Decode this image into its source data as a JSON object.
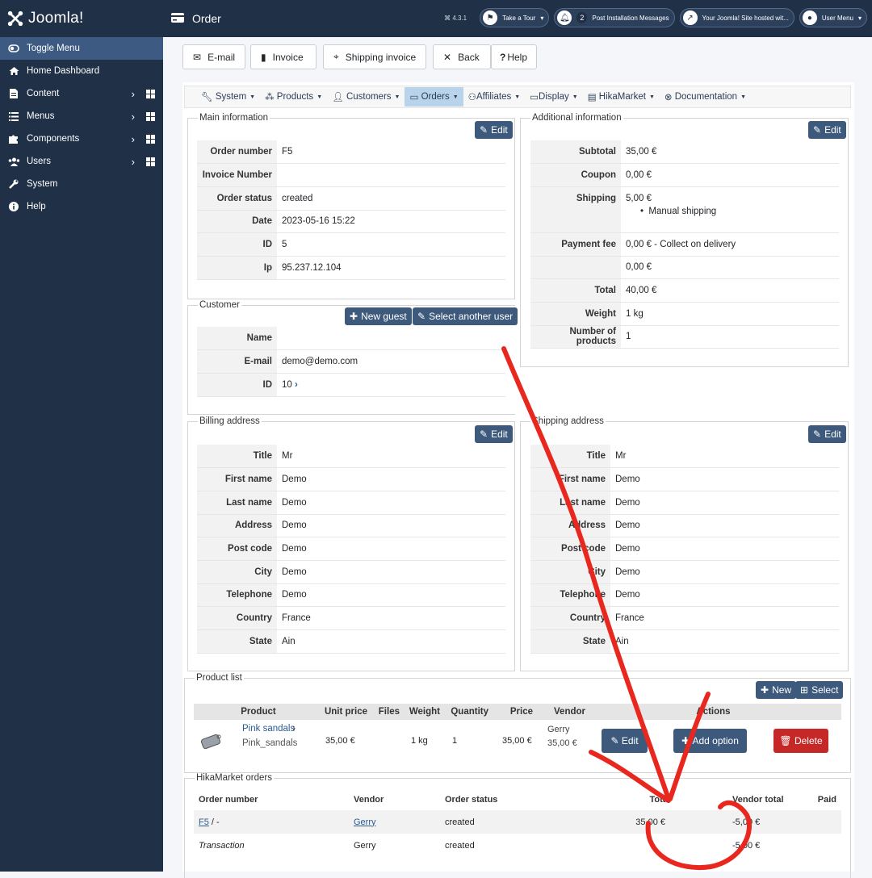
{
  "app": {
    "logo_text": "Joomla!",
    "page_title": "Order",
    "version": "4.3.1"
  },
  "header": {
    "take_tour": "Take a Tour",
    "post_install_count": "2",
    "post_install": "Post Installation Messages",
    "site_hosted": "Your Joomla! Site hosted wit...",
    "user_menu": "User Menu"
  },
  "sidebar": {
    "items": [
      {
        "label": "Toggle Menu",
        "icon": "toggle-icon"
      },
      {
        "label": "Home Dashboard",
        "icon": "home-icon"
      },
      {
        "label": "Content",
        "icon": "file-icon"
      },
      {
        "label": "Menus",
        "icon": "list-icon"
      },
      {
        "label": "Components",
        "icon": "puzzle-icon"
      },
      {
        "label": "Users",
        "icon": "users-icon"
      },
      {
        "label": "System",
        "icon": "wrench-icon"
      },
      {
        "label": "Help",
        "icon": "info-icon"
      }
    ]
  },
  "toolbar": {
    "email": "E-mail",
    "invoice": "Invoice",
    "shipping_invoice": "Shipping invoice",
    "back": "Back",
    "help": "Help"
  },
  "submenu": {
    "system": "System",
    "products": "Products",
    "customers": "Customers",
    "orders": "Orders",
    "affiliates": "Affiliates",
    "display": "Display",
    "hikamarket": "HikaMarket",
    "documentation": "Documentation"
  },
  "main_info": {
    "legend": "Main information",
    "edit": "Edit",
    "rows": [
      {
        "k": "Order number",
        "v": "F5"
      },
      {
        "k": "Invoice Number",
        "v": ""
      },
      {
        "k": "Order status",
        "v": "created"
      },
      {
        "k": "Date",
        "v": "2023-05-16 15:22"
      },
      {
        "k": "ID",
        "v": "5"
      },
      {
        "k": "Ip",
        "v": "95.237.12.104"
      }
    ]
  },
  "additional": {
    "legend": "Additional information",
    "edit": "Edit",
    "subtotal_k": "Subtotal",
    "subtotal_v": "35,00 €",
    "coupon_k": "Coupon",
    "coupon_v": "0,00 €",
    "shipping_k": "Shipping",
    "shipping_v": "5,00 €",
    "shipping_method": "Manual shipping",
    "payment_k": "Payment fee",
    "payment_v": "0,00 € - Collect on delivery",
    "blank_v": "0,00 €",
    "total_k": "Total",
    "total_v": "40,00 €",
    "weight_k": "Weight",
    "weight_v": "1 kg",
    "nprod_k": "Number of products",
    "nprod_v": "1"
  },
  "customer": {
    "legend": "Customer",
    "new_guest": "New guest",
    "select_user": "Select another user",
    "name_k": "Name",
    "name_v": "",
    "email_k": "E-mail",
    "email_v": "demo@demo.com",
    "id_k": "ID",
    "id_v": "10"
  },
  "billing": {
    "legend": "Billing address",
    "edit": "Edit",
    "rows": [
      {
        "k": "Title",
        "v": "Mr"
      },
      {
        "k": "First name",
        "v": "Demo"
      },
      {
        "k": "Last name",
        "v": "Demo"
      },
      {
        "k": "Address",
        "v": "Demo"
      },
      {
        "k": "Post code",
        "v": "Demo"
      },
      {
        "k": "City",
        "v": "Demo"
      },
      {
        "k": "Telephone",
        "v": "Demo"
      },
      {
        "k": "Country",
        "v": "France"
      },
      {
        "k": "State",
        "v": "Ain"
      }
    ]
  },
  "shipping": {
    "legend": "Shipping address",
    "edit": "Edit",
    "rows": [
      {
        "k": "Title",
        "v": "Mr"
      },
      {
        "k": "First name",
        "v": "Demo"
      },
      {
        "k": "Last name",
        "v": "Demo"
      },
      {
        "k": "Address",
        "v": "Demo"
      },
      {
        "k": "Post code",
        "v": "Demo"
      },
      {
        "k": "City",
        "v": "Demo"
      },
      {
        "k": "Telephone",
        "v": "Demo"
      },
      {
        "k": "Country",
        "v": "France"
      },
      {
        "k": "State",
        "v": "Ain"
      }
    ]
  },
  "products": {
    "legend": "Product list",
    "new": "New",
    "select": "Select",
    "headers": [
      "Product",
      "Unit price",
      "Files",
      "Weight",
      "Quantity",
      "Price",
      "Vendor",
      "Actions"
    ],
    "row": {
      "name": "Pink sandals",
      "code": "Pink_sandals",
      "unit_price": "35,00 €",
      "files": "",
      "weight": "1 kg",
      "quantity": "1",
      "price": "35,00 €",
      "vendor_name": "Gerry",
      "vendor_amount": "35,00 €",
      "edit": "Edit",
      "add_option": "Add option",
      "delete": "Delete"
    }
  },
  "hikamarket": {
    "legend": "HikaMarket orders",
    "headers": [
      "Order number",
      "Vendor",
      "Order status",
      "Total",
      "Vendor total",
      "Paid"
    ],
    "rows": [
      {
        "order": "F5",
        "order_suffix": " / -",
        "vendor": "Gerry",
        "status": "created",
        "total": "35,00 €",
        "vendor_total": "-5,00 €",
        "paid": ""
      },
      {
        "order": "Transaction",
        "order_suffix": "",
        "vendor": "Gerry",
        "status": "created",
        "total": "",
        "vendor_total": "-5,00 €",
        "paid": ""
      }
    ]
  },
  "colors": {
    "sidebar": "#1f3047",
    "button": "#3d5a7d",
    "danger": "#c52827",
    "annotation": "#e8281e"
  }
}
